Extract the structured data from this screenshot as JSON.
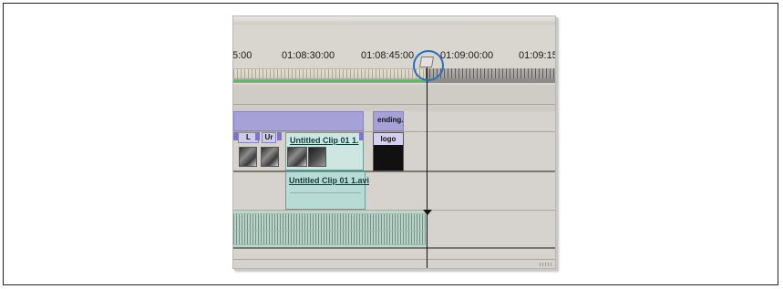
{
  "timeline": {
    "timecodes": [
      "5:00",
      "01:08:30:00",
      "01:08:45:00",
      "01:09:00:00",
      "01:09:15"
    ]
  },
  "video_track": {
    "clip_main": "Untitled Clip 01 1.",
    "clip_small_a": "L",
    "clip_small_b": "Ur",
    "ending_title": "ending.j",
    "logo_title": "logo"
  },
  "audio_track": {
    "clip_name": "Untitled Clip 01 1.avi"
  },
  "colors": {
    "highlight": "#2a6ec0",
    "transition": "#a6a1d6",
    "clip": "#bcdcd8",
    "audio_marker": "#4cc24e"
  }
}
